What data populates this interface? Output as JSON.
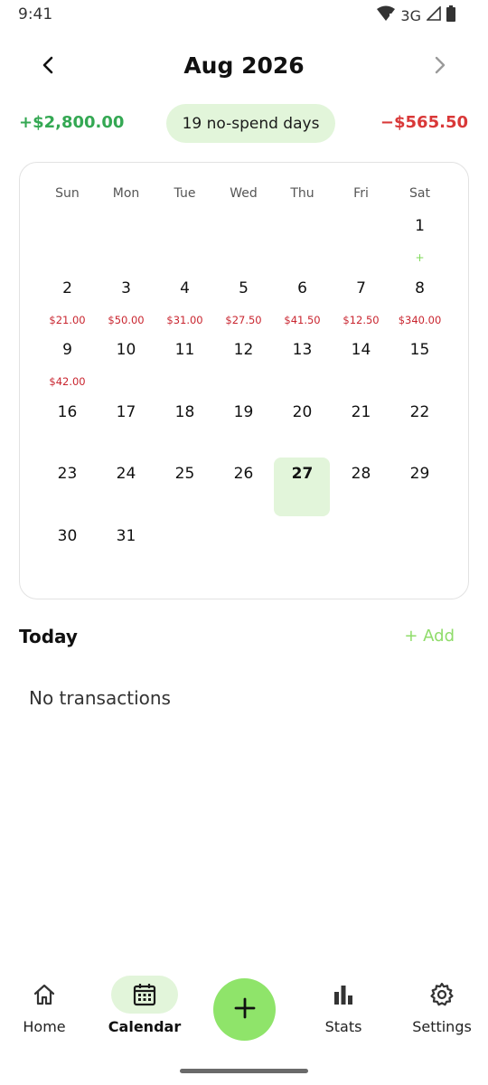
{
  "status_bar": {
    "time": "9:41",
    "network": "3G"
  },
  "header": {
    "month_title": "Aug 2026",
    "prev_icon": "chevron-left-icon",
    "next_icon": "chevron-right-icon"
  },
  "summary": {
    "income": "+$2,800.00",
    "no_spend": "19 no-spend days",
    "expense": "−$565.50"
  },
  "calendar": {
    "weekdays": [
      "Sun",
      "Mon",
      "Tue",
      "Wed",
      "Thu",
      "Fri",
      "Sat"
    ],
    "leading_blanks": 6,
    "today": 27,
    "days": [
      {
        "day": "1",
        "amount": "+",
        "type": "income"
      },
      {
        "day": "2",
        "amount": "$21.00",
        "type": "expense"
      },
      {
        "day": "3",
        "amount": "$50.00",
        "type": "expense"
      },
      {
        "day": "4",
        "amount": "$31.00",
        "type": "expense"
      },
      {
        "day": "5",
        "amount": "$27.50",
        "type": "expense"
      },
      {
        "day": "6",
        "amount": "$41.50",
        "type": "expense"
      },
      {
        "day": "7",
        "amount": "$12.50",
        "type": "expense"
      },
      {
        "day": "8",
        "amount": "$340.00",
        "type": "expense"
      },
      {
        "day": "9",
        "amount": "$42.00",
        "type": "expense"
      },
      {
        "day": "10",
        "amount": ""
      },
      {
        "day": "11",
        "amount": ""
      },
      {
        "day": "12",
        "amount": ""
      },
      {
        "day": "13",
        "amount": ""
      },
      {
        "day": "14",
        "amount": ""
      },
      {
        "day": "15",
        "amount": ""
      },
      {
        "day": "16",
        "amount": ""
      },
      {
        "day": "17",
        "amount": ""
      },
      {
        "day": "18",
        "amount": ""
      },
      {
        "day": "19",
        "amount": ""
      },
      {
        "day": "20",
        "amount": ""
      },
      {
        "day": "21",
        "amount": ""
      },
      {
        "day": "22",
        "amount": ""
      },
      {
        "day": "23",
        "amount": ""
      },
      {
        "day": "24",
        "amount": ""
      },
      {
        "day": "25",
        "amount": ""
      },
      {
        "day": "26",
        "amount": ""
      },
      {
        "day": "27",
        "amount": ""
      },
      {
        "day": "28",
        "amount": ""
      },
      {
        "day": "29",
        "amount": ""
      },
      {
        "day": "30",
        "amount": ""
      },
      {
        "day": "31",
        "amount": ""
      }
    ]
  },
  "today_section": {
    "title": "Today",
    "add_label": "+ Add",
    "empty_text": "No transactions"
  },
  "bottom_nav": {
    "items": [
      {
        "label": "Home",
        "icon": "home-icon",
        "active": false
      },
      {
        "label": "Calendar",
        "icon": "calendar-icon",
        "active": true
      },
      {
        "label": "Stats",
        "icon": "bar-chart-icon",
        "active": false
      },
      {
        "label": "Settings",
        "icon": "gear-icon",
        "active": false
      }
    ],
    "fab_icon": "plus-icon"
  },
  "colors": {
    "income": "#34a853",
    "expense": "#d93838",
    "accent": "#8fe46a",
    "accent_light": "#e2f5da"
  }
}
